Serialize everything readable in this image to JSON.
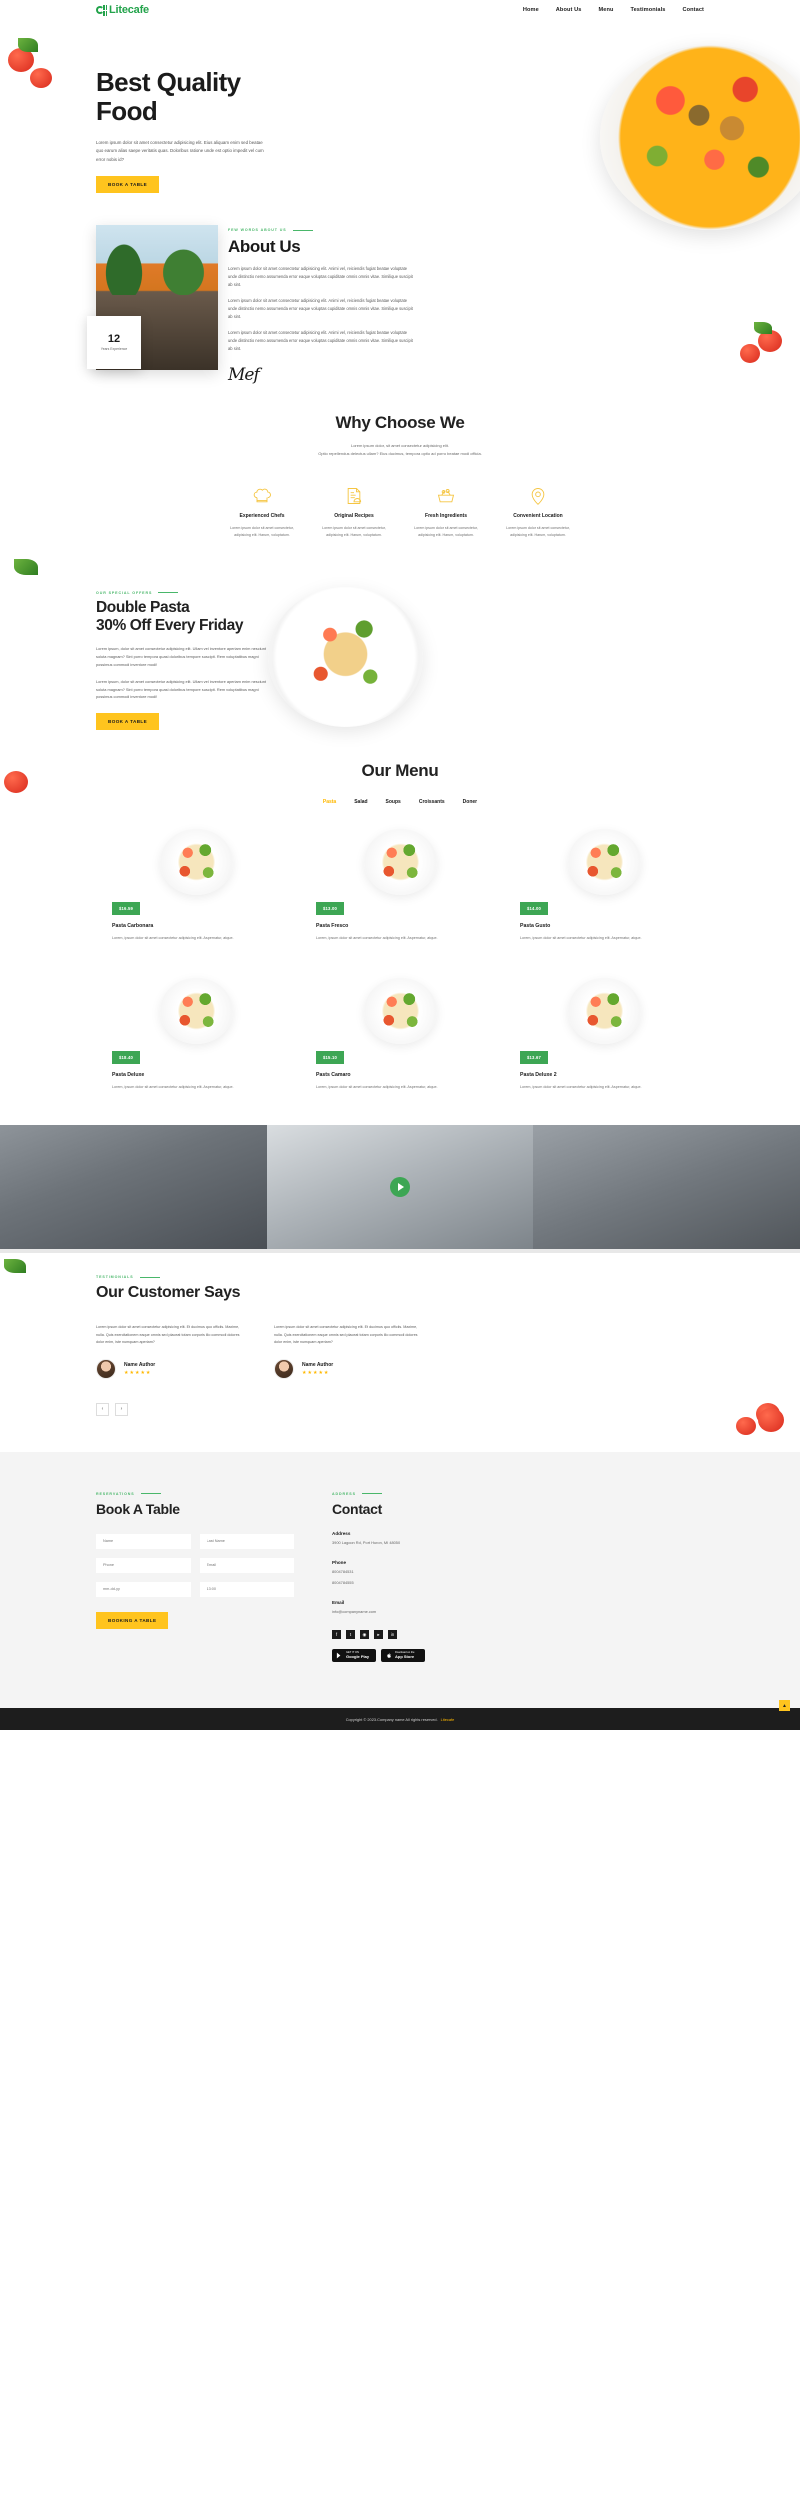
{
  "brand": {
    "name": "Litecafe",
    "color": "#23a34b"
  },
  "nav": {
    "items": [
      {
        "label": "Home"
      },
      {
        "label": "About Us"
      },
      {
        "label": "Menu"
      },
      {
        "label": "Testimonials"
      },
      {
        "label": "Contact"
      }
    ]
  },
  "hero": {
    "title": "Best Quality Food",
    "paragraph": "Lorem ipsum dolor sit amet consectetur adipisicing elit. Eius aliquam enim sed beatae quo earum alias saepe veritatis quas. Doloribus ratione unde est optio impedit vel cum error nobis id?",
    "cta": "BOOK A TABLE"
  },
  "about": {
    "eyebrow": "FEW WORDS ABOUT US",
    "title": "About Us",
    "paragraph1": "Lorem ipsum dolor sit amet consectetur adipisicing elit. Animi vel, reiciendis fugiat beatae voluptate unde distinctio nemo assumenda error eaque voluptas cupiditate omnis omnis vitae. Similique suscipit ab sint.",
    "paragraph2": "Lorem ipsum dolor sit amet consectetur adipisicing elit. Animi vel, reiciendis fugiat beatae voluptate unde distinctio nemo assumenda error eaque voluptas cupiditate omnis omnis vitae. Similique suscipit ab sint.",
    "paragraph3": "Lorem ipsum dolor sit amet consectetur adipisicing elit. Animi vel, reiciendis fugiat beatae voluptate unde distinctio nemo assumenda error eaque voluptas cupiditate omnis omnis vitae. Similique suscipit ab sint.",
    "signature": "Mef",
    "badge_number": "12",
    "badge_label": "Years Experience"
  },
  "why": {
    "title": "Why Choose We",
    "subtitle_line1": "Lorem ipsum dolor, sit amet consectetur adipisicing elit.",
    "subtitle_line2": "Optio repellendus delectus ullam? Eius ducimus, tempora optio ad porro beatae modi officia.",
    "features": [
      {
        "icon": "chef-hat-icon",
        "title": "Experienced Chefs",
        "text": "Lorem ipsum dolor sit amet consectetur, adipisicing elit. Harum, voluptatum."
      },
      {
        "icon": "recipe-document-icon",
        "title": "Original Recipes",
        "text": "Lorem ipsum dolor sit amet consectetur, adipisicing elit. Harum, voluptatum."
      },
      {
        "icon": "fresh-basket-icon",
        "title": "Fresh Ingredients",
        "text": "Lorem ipsum dolor sit amet consectetur, adipisicing elit. Harum, voluptatum."
      },
      {
        "icon": "location-pin-icon",
        "title": "Convenient Location",
        "text": "Lorem ipsum dolor sit amet consectetur, adipisicing elit. Harum, voluptatum."
      }
    ]
  },
  "offer": {
    "eyebrow": "OUR SPECIAL OFFERS",
    "title_line1": "Double Pasta",
    "title_line2": "30% Off Every Friday",
    "paragraph1": "Lorem ipsum, dolor sit amet consectetur adipisicing elit. Ullam vel inventore aperiam enim nesciunt soluta magnam? Sint porro tempora quasi doloribus tempore suscipit. Rem voluptatibus magni possimus commodi inventore modi!",
    "paragraph2": "Lorem ipsum, dolor sit amet consectetur adipisicing elit. Ullam vel inventore aperiam enim nesciunt soluta magnam? Sint porro tempora quasi doloribus tempore suscipit. Rem voluptatibus magni possimus commodi inventore modi!",
    "cta": "BOOK A TABLE"
  },
  "menu": {
    "title": "Our Menu",
    "tabs": [
      {
        "label": "Pasta",
        "active": true
      },
      {
        "label": "Salad",
        "active": false
      },
      {
        "label": "Soups",
        "active": false
      },
      {
        "label": "Croissants",
        "active": false
      },
      {
        "label": "Doner",
        "active": false
      }
    ],
    "items": [
      {
        "price": "$16.59",
        "name": "Pasta Carbonara",
        "desc": "Lorem, ipsum dolor sit amet consectetur adipisicing elit. Aspernatur, atque."
      },
      {
        "price": "$13.00",
        "name": "Pasta Fresco",
        "desc": "Lorem, ipsum dolor sit amet consectetur adipisicing elit. Aspernatur, atque."
      },
      {
        "price": "$14.00",
        "name": "Pasta Gusto",
        "desc": "Lorem, ipsum dolor sit amet consectetur adipisicing elit. Aspernatur, atque."
      },
      {
        "price": "$18.40",
        "name": "Pasta Deluxe",
        "desc": "Lorem, ipsum dolor sit amet consectetur adipisicing elit. Aspernatur, atque."
      },
      {
        "price": "$15.10",
        "name": "Pasts Camaro",
        "desc": "Lorem, ipsum dolor sit amet consectetur adipisicing elit. Aspernatur, atque."
      },
      {
        "price": "$13.67",
        "name": "Pasta Deluxe 2",
        "desc": "Lorem, ipsum dolor sit amet consectetur adipisicing elit. Aspernatur, atque."
      }
    ]
  },
  "video": {
    "play_label": "play-video"
  },
  "testimonials": {
    "eyebrow": "TESTIMONIALS",
    "title": "Our Customer Says",
    "items": [
      {
        "text": "Lorem ipsum dolor sit amet consectetur adipisicing elit. Et ducimus quo officiis. Maxime, nulla. Quis exercitationem eaque omnis sed placeat totam corporis illo commodi dolores dolor enim, iste numquam aperiam?",
        "name": "Name Author",
        "stars": "★★★★★"
      },
      {
        "text": "Lorem ipsum dolor sit amet consectetur adipisicing elit. Et ducimus quo officiis. Maxime, nulla. Quis exercitationem eaque omnis sed placeat totam corporis illo commodi dolores dolor enim, iste numquam aperiam?",
        "name": "Name Author",
        "stars": "★★★★★"
      }
    ],
    "prev": "‹",
    "next": "›"
  },
  "booking": {
    "eyebrow": "RESERVATIONS",
    "title": "Book A Table",
    "fields": [
      {
        "placeholder": "Name"
      },
      {
        "placeholder": "Last Name"
      },
      {
        "placeholder": "Phone"
      },
      {
        "placeholder": "Email"
      },
      {
        "placeholder": "mm-dd-yy"
      },
      {
        "placeholder": "13:00"
      }
    ],
    "cta": "BOOKING A TABLE"
  },
  "contact": {
    "eyebrow": "ADDRESS",
    "title": "Contact",
    "address_label": "Address",
    "address_value": "3900 Lagoon Rd, Port Huron, MI 48050",
    "phone_label": "Phone",
    "phone_value1": "8004784531",
    "phone_value2": "8004784555",
    "email_label": "Email",
    "email_value": "info@companyname.com",
    "socials": [
      {
        "icon": "facebook-icon",
        "glyph": "f"
      },
      {
        "icon": "twitter-icon",
        "glyph": "t"
      },
      {
        "icon": "instagram-icon",
        "glyph": "◉"
      },
      {
        "icon": "youtube-icon",
        "glyph": "▸"
      },
      {
        "icon": "linkedin-icon",
        "glyph": "in"
      }
    ],
    "stores": [
      {
        "icon": "google-play-icon",
        "small": "GET IT ON",
        "large": "Google Play"
      },
      {
        "icon": "app-store-icon",
        "small": "Download on the",
        "large": "App Store"
      }
    ]
  },
  "footer": {
    "text": "Copyright © 2023.Company name All rights reserved.",
    "link": "Litecafe",
    "to_top": "▲"
  },
  "colors": {
    "green": "#3da654",
    "yellow": "#ffc41e",
    "dark": "#1b1b1b"
  }
}
